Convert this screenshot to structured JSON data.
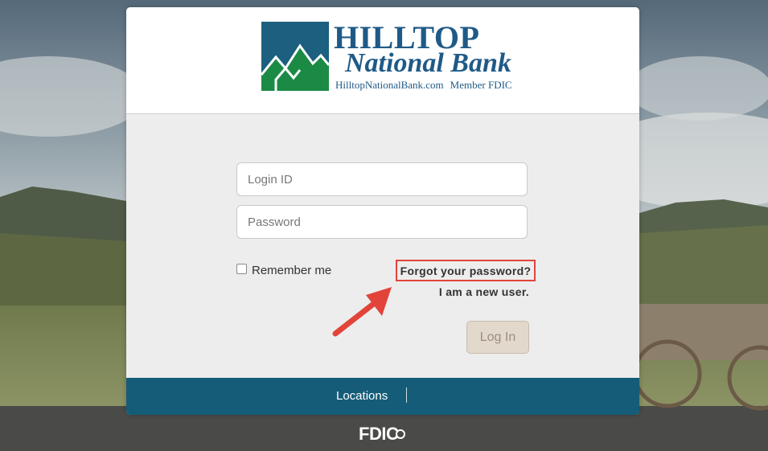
{
  "brand": {
    "name": "HILLTOP",
    "script": "National Bank",
    "website": "HilltopNationalBank.com",
    "member": "Member FDIC",
    "color_primary": "#1f5a87",
    "color_mountain": "#1b8a45",
    "color_tile": "#1c5f7e"
  },
  "form": {
    "login_placeholder": "Login ID",
    "password_placeholder": "Password",
    "remember_label": "Remember me",
    "remember_checked": false,
    "forgot_label": "Forgot your password?",
    "new_user_label": "I am a new user.",
    "login_button_label": "Log In"
  },
  "footer": {
    "locations_label": "Locations",
    "fdic_label": "FDIC"
  },
  "annotations": {
    "highlight_color": "#e2443a",
    "arrow_icon": "red-arrow-icon"
  }
}
